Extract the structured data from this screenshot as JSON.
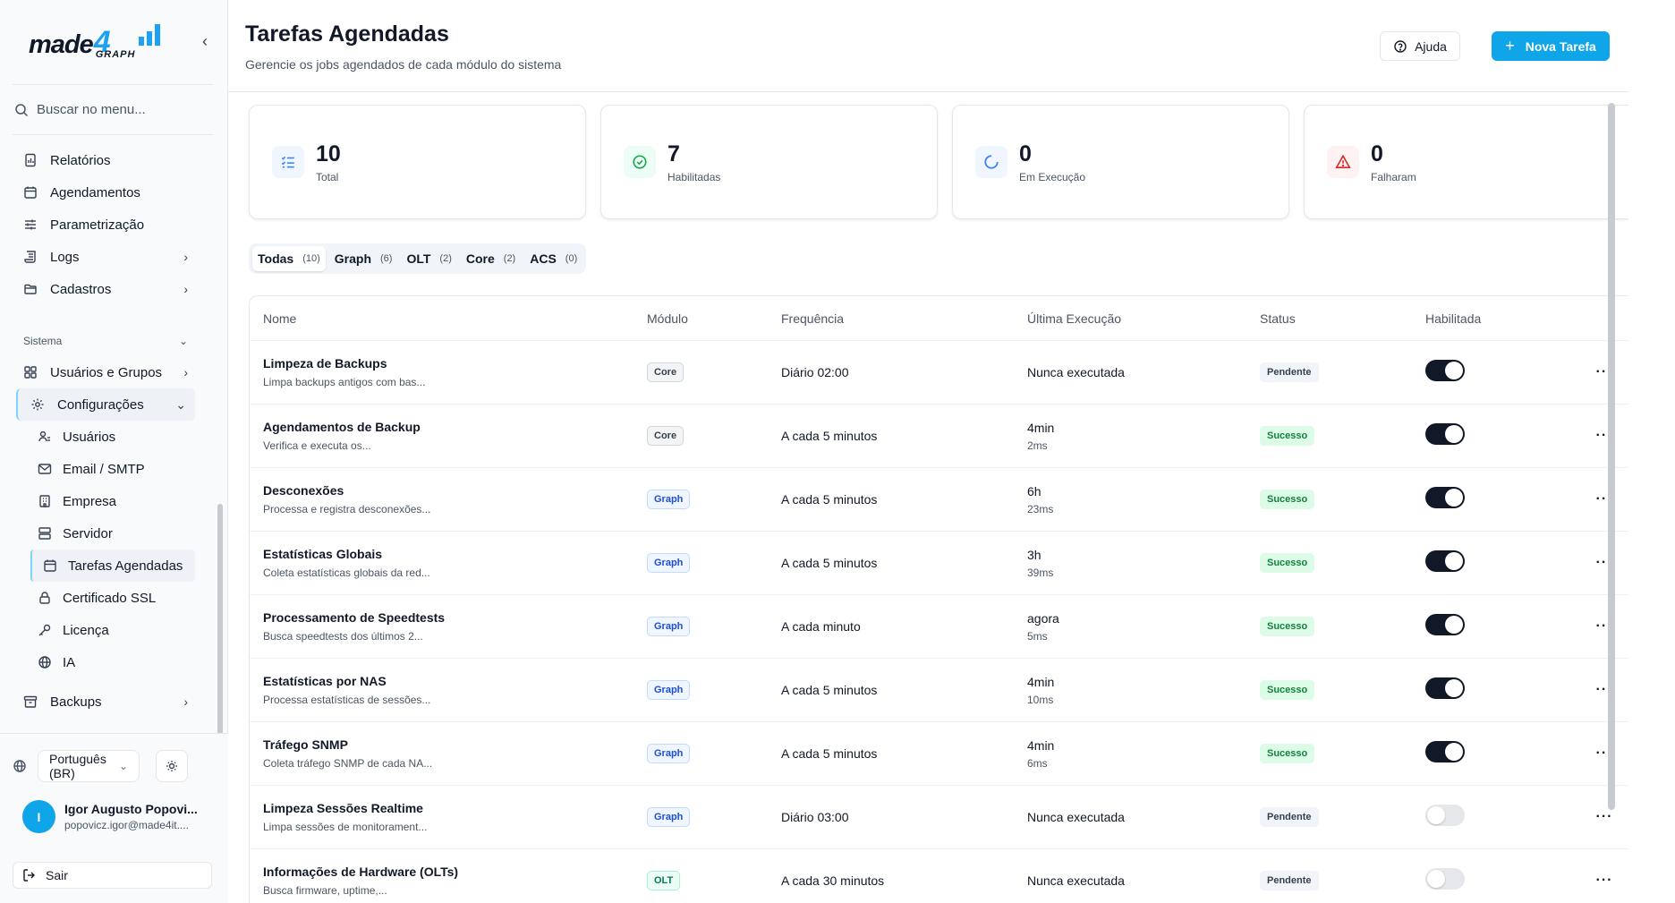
{
  "brand": {
    "logo_main": "made",
    "logo_four": "4",
    "logo_sub": "GRAPH",
    "accent": "#0ea5e9"
  },
  "sidebar": {
    "search_placeholder": "Buscar no menu...",
    "items": [
      {
        "label": "Relatórios",
        "icon": "report-icon"
      },
      {
        "label": "Agendamentos",
        "icon": "calendar-icon"
      },
      {
        "label": "Parametrização",
        "icon": "sliders-icon"
      },
      {
        "label": "Logs",
        "icon": "scroll-icon"
      },
      {
        "label": "Cadastros",
        "icon": "folder-icon"
      }
    ],
    "section_label": "Sistema",
    "system_items": [
      {
        "label": "Usuários e Grupos"
      },
      {
        "label": "Configurações"
      }
    ],
    "config_items": [
      {
        "label": "Usuários"
      },
      {
        "label": "Email / SMTP"
      },
      {
        "label": "Empresa"
      },
      {
        "label": "Servidor"
      },
      {
        "label": "Tarefas Agendadas"
      },
      {
        "label": "Certificado SSL"
      },
      {
        "label": "Licença"
      },
      {
        "label": "IA"
      }
    ],
    "backups_label": "Backups",
    "language": "Português (BR)",
    "user": {
      "initial": "I",
      "name": "Igor Augusto Popovi...",
      "email": "popovicz.igor@made4it...."
    },
    "logout_label": "Sair"
  },
  "header": {
    "title": "Tarefas Agendadas",
    "subtitle": "Gerencie os jobs agendados de cada módulo do sistema",
    "help_label": "Ajuda",
    "new_label": "Nova Tarefa"
  },
  "stats": [
    {
      "value": "10",
      "label": "Total",
      "color": "#3b82f6",
      "bg": "#eff6ff"
    },
    {
      "value": "7",
      "label": "Habilitadas",
      "color": "#16a34a",
      "bg": "#ecfdf5"
    },
    {
      "value": "0",
      "label": "Em Execução",
      "color": "#3b82f6",
      "bg": "#eff6ff"
    },
    {
      "value": "0",
      "label": "Falharam",
      "color": "#dc2626",
      "bg": "#fef2f2"
    }
  ],
  "tabs": [
    {
      "label": "Todas",
      "count": "(10)"
    },
    {
      "label": "Graph",
      "count": "(6)"
    },
    {
      "label": "OLT",
      "count": "(2)"
    },
    {
      "label": "Core",
      "count": "(2)"
    },
    {
      "label": "ACS",
      "count": "(0)"
    }
  ],
  "table": {
    "headers": {
      "name": "Nome",
      "module": "Módulo",
      "frequency": "Frequência",
      "last_run": "Última Execução",
      "status": "Status",
      "enabled": "Habilitada"
    },
    "rows": [
      {
        "name": "Limpeza de Backups",
        "desc": "Limpa backups antigos com bas...",
        "module": "Core",
        "freq": "Diário 02:00",
        "last": "Nunca executada",
        "last_sub": "",
        "status": "Pendente",
        "enabled": true
      },
      {
        "name": "Agendamentos de Backup",
        "desc": "Verifica e executa os...",
        "module": "Core",
        "freq": "A cada 5 minutos",
        "last": "4min",
        "last_sub": "2ms",
        "status": "Sucesso",
        "enabled": true
      },
      {
        "name": "Desconexões",
        "desc": "Processa e registra desconexões...",
        "module": "Graph",
        "freq": "A cada 5 minutos",
        "last": "6h",
        "last_sub": "23ms",
        "status": "Sucesso",
        "enabled": true
      },
      {
        "name": "Estatísticas Globais",
        "desc": "Coleta estatísticas globais da red...",
        "module": "Graph",
        "freq": "A cada 5 minutos",
        "last": "3h",
        "last_sub": "39ms",
        "status": "Sucesso",
        "enabled": true
      },
      {
        "name": "Processamento de Speedtests",
        "desc": "Busca speedtests dos últimos 2...",
        "module": "Graph",
        "freq": "A cada minuto",
        "last": "agora",
        "last_sub": "5ms",
        "status": "Sucesso",
        "enabled": true
      },
      {
        "name": "Estatísticas por NAS",
        "desc": "Processa estatísticas de sessões...",
        "module": "Graph",
        "freq": "A cada 5 minutos",
        "last": "4min",
        "last_sub": "10ms",
        "status": "Sucesso",
        "enabled": true
      },
      {
        "name": "Tráfego SNMP",
        "desc": "Coleta tráfego SNMP de cada NA...",
        "module": "Graph",
        "freq": "A cada 5 minutos",
        "last": "4min",
        "last_sub": "6ms",
        "status": "Sucesso",
        "enabled": true
      },
      {
        "name": "Limpeza Sessões Realtime",
        "desc": "Limpa sessões de monitorament...",
        "module": "Graph",
        "freq": "Diário 03:00",
        "last": "Nunca executada",
        "last_sub": "",
        "status": "Pendente",
        "enabled": false
      },
      {
        "name": "Informações de Hardware (OLTs)",
        "desc": "Busca firmware, uptime,...",
        "module": "OLT",
        "freq": "A cada 30 minutos",
        "last": "Nunca executada",
        "last_sub": "",
        "status": "Pendente",
        "enabled": false
      }
    ]
  }
}
